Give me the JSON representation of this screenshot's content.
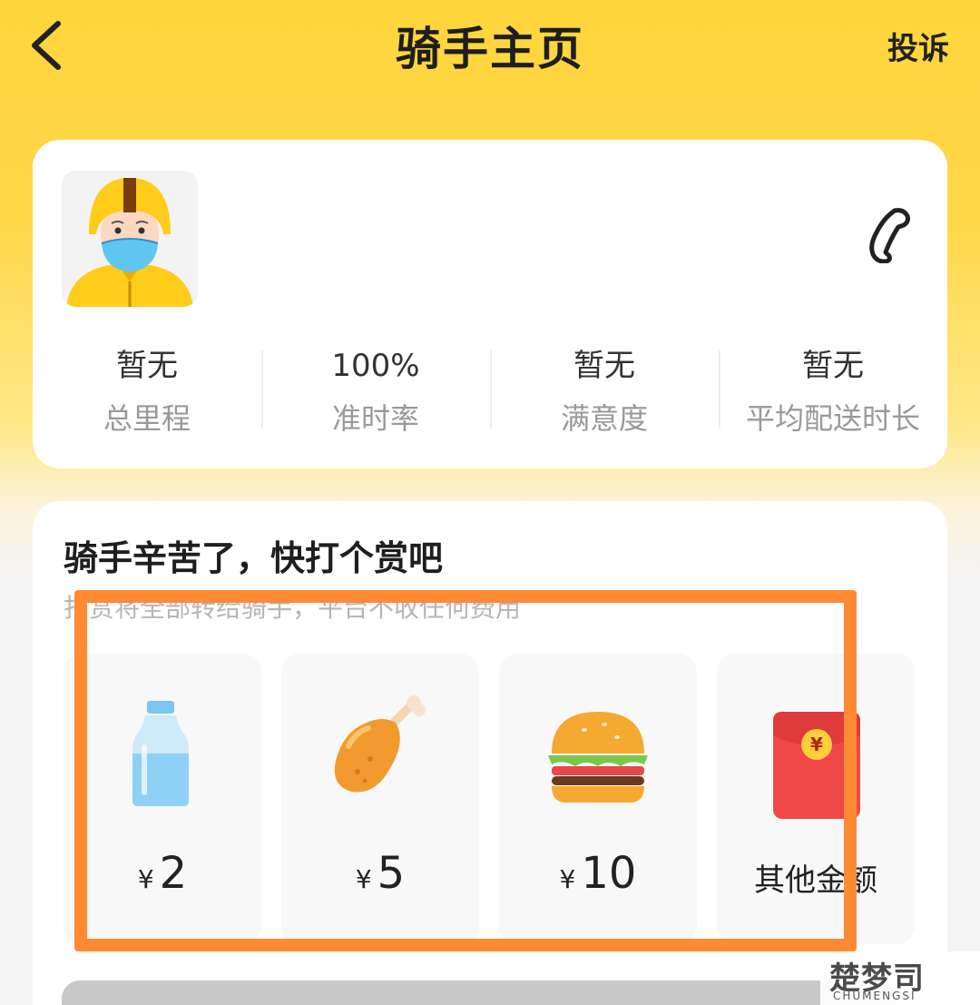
{
  "header": {
    "title": "骑手主页",
    "complain_label": "投诉"
  },
  "rider": {
    "stats": [
      {
        "value": "暂无",
        "label": "总里程"
      },
      {
        "value": "100%",
        "label": "准时率"
      },
      {
        "value": "暂无",
        "label": "满意度"
      },
      {
        "value": "暂无",
        "label": "平均配送时长"
      }
    ]
  },
  "tip": {
    "title": "骑手辛苦了，快打个赏吧",
    "subtitle": "打赏将全部转给骑手，平台不收任何费用",
    "options": [
      {
        "currency": "¥",
        "amount": "2",
        "icon": "water-bottle-icon"
      },
      {
        "currency": "¥",
        "amount": "5",
        "icon": "chicken-leg-icon"
      },
      {
        "currency": "¥",
        "amount": "10",
        "icon": "burger-icon"
      },
      {
        "label": "其他金额",
        "icon": "red-envelope-icon"
      }
    ]
  },
  "watermark": {
    "main": "楚梦司",
    "sub": "CHUMENGSI"
  },
  "colors": {
    "brand_yellow": "#ffd53b",
    "highlight_orange": "#ff8a33"
  }
}
